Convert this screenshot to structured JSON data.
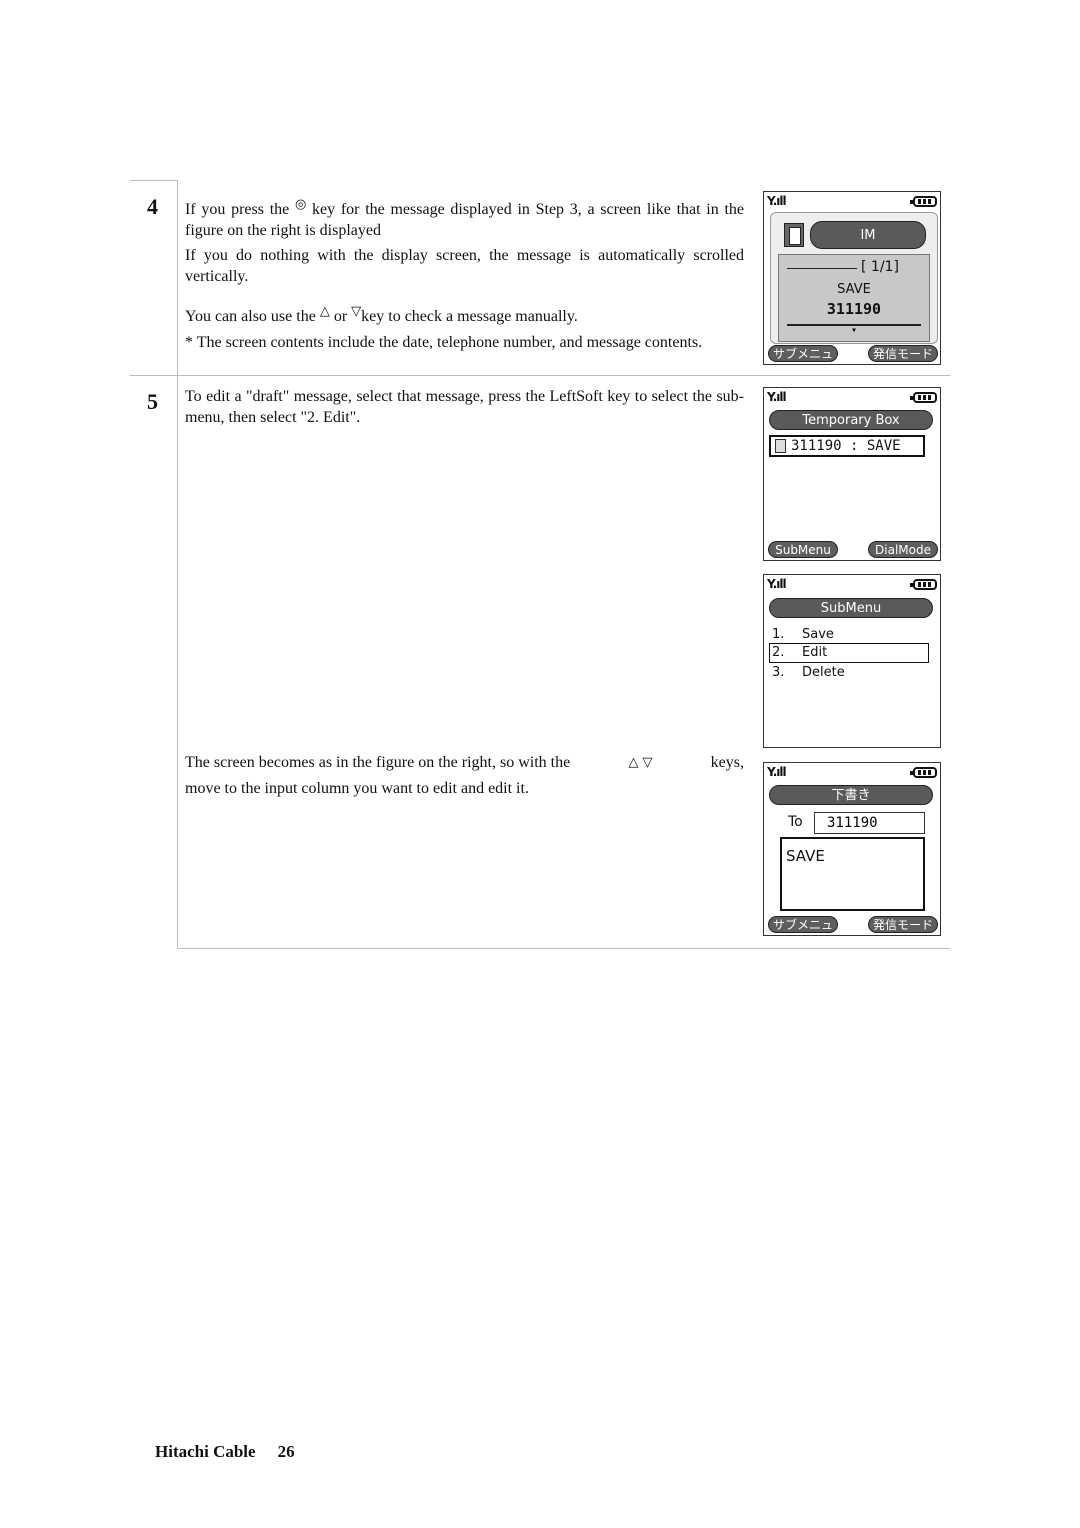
{
  "steps": [
    {
      "number": "4",
      "paragraphs": {
        "p1_before_icon": "If you press the",
        "p1_icon": "select-key-icon",
        "p1_after_icon": "key for the message displayed in Step 3, a screen like that in the figure on the right is displayed",
        "p2": "If you do nothing with the display screen, the message is automatically scrolled vertically.",
        "p3_before": "You can also use the",
        "p3_up_icon": "up-key-icon",
        "p3_mid": "or",
        "p3_down_icon": "down-key-icon",
        "p3_after": "key to check a message manually.",
        "p4": "* The screen contents include the date, telephone number, and message contents."
      }
    },
    {
      "number": "5",
      "paragraphs": {
        "p1": "To edit a \"draft\" message, select that message, press the LeftSoft key to select the sub-menu, then select \"2. Edit\".",
        "p2_before": "The screen becomes as in the figure on the right, so with the",
        "p2_after": "keys,",
        "p2_line2": "move to the input column you want to edit and edit it."
      }
    }
  ],
  "glyphs": {
    "select_key": "◎",
    "up_key": "△",
    "down_key": "▽"
  },
  "screens": {
    "im_view": {
      "title": "IM",
      "counter": "[ 1/1]",
      "message": "SAVE",
      "number": "311190",
      "scroll_indicator": "▾",
      "softkey_left": "サブメニュー",
      "softkey_right": "発信モード"
    },
    "temporary_box": {
      "title": "Temporary Box",
      "item": "311190 : SAVE",
      "softkey_left": "SubMenu",
      "softkey_right": "DialMode"
    },
    "submenu": {
      "title": "SubMenu",
      "items": [
        {
          "num": "1.",
          "label": "Save"
        },
        {
          "num": "2.",
          "label": "Edit"
        },
        {
          "num": "3.",
          "label": "Delete"
        }
      ],
      "selected_index": 1
    },
    "draft_edit": {
      "title": "下書き",
      "to_label": "To",
      "to_value": "311190",
      "body": "SAVE",
      "softkey_left": "サブメニュー",
      "softkey_right": "発信モード"
    }
  },
  "status_bar": {
    "signal": "Y.ıll",
    "battery_bars": 3
  },
  "footer": {
    "company": "Hitachi Cable",
    "page": "26"
  },
  "colors": {
    "pill_bg": "#5a5a5a",
    "screen_gray": "#c8c8c8",
    "rule": "#bdbdbd"
  }
}
